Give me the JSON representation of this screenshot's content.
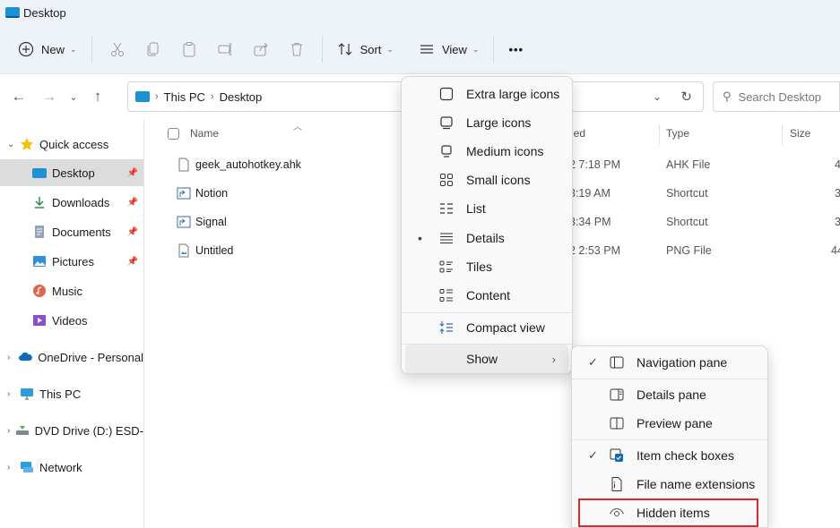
{
  "window": {
    "title": "Desktop"
  },
  "toolbar": {
    "new_label": "New",
    "sort_label": "Sort",
    "view_label": "View",
    "more_label": "•••"
  },
  "address": {
    "crumbs": [
      "This PC",
      "Desktop"
    ],
    "search_placeholder": "Search Desktop"
  },
  "sidebar": {
    "items": [
      {
        "label": "Quick access"
      },
      {
        "label": "Desktop"
      },
      {
        "label": "Downloads"
      },
      {
        "label": "Documents"
      },
      {
        "label": "Pictures"
      },
      {
        "label": "Music"
      },
      {
        "label": "Videos"
      },
      {
        "label": "OneDrive - Personal"
      },
      {
        "label": "This PC"
      },
      {
        "label": "DVD Drive (D:) ESD-"
      },
      {
        "label": "Network"
      }
    ]
  },
  "filelist": {
    "columns": {
      "name": "Name",
      "modified": "ied",
      "type": "Type",
      "size": "Size"
    },
    "rows": [
      {
        "name": "geek_autohotkey.ahk",
        "modified": "2 7:18 PM",
        "type": "AHK File",
        "size": "4"
      },
      {
        "name": "Notion",
        "modified": "3:19 AM",
        "type": "Shortcut",
        "size": "3"
      },
      {
        "name": "Signal",
        "modified": "3:34 PM",
        "type": "Shortcut",
        "size": "3"
      },
      {
        "name": "Untitled",
        "modified": "2 2:53 PM",
        "type": "PNG File",
        "size": "44"
      }
    ]
  },
  "view_menu": {
    "items": [
      {
        "label": "Extra large icons"
      },
      {
        "label": "Large icons"
      },
      {
        "label": "Medium icons"
      },
      {
        "label": "Small icons"
      },
      {
        "label": "List"
      },
      {
        "label": "Details",
        "bullet": "•"
      },
      {
        "label": "Tiles"
      },
      {
        "label": "Content"
      },
      {
        "label": "Compact view"
      },
      {
        "label": "Show"
      }
    ]
  },
  "show_menu": {
    "items": [
      {
        "label": "Navigation pane",
        "check": "✓"
      },
      {
        "label": "Details pane"
      },
      {
        "label": "Preview pane"
      },
      {
        "label": "Item check boxes",
        "check": "✓"
      },
      {
        "label": "File name extensions"
      },
      {
        "label": "Hidden items"
      }
    ]
  },
  "colors": {
    "accent": "#1e90d6",
    "highlight": "#d9282f",
    "selected_bg": "#dcdcdc",
    "menu_bg": "#f9f9f9"
  }
}
